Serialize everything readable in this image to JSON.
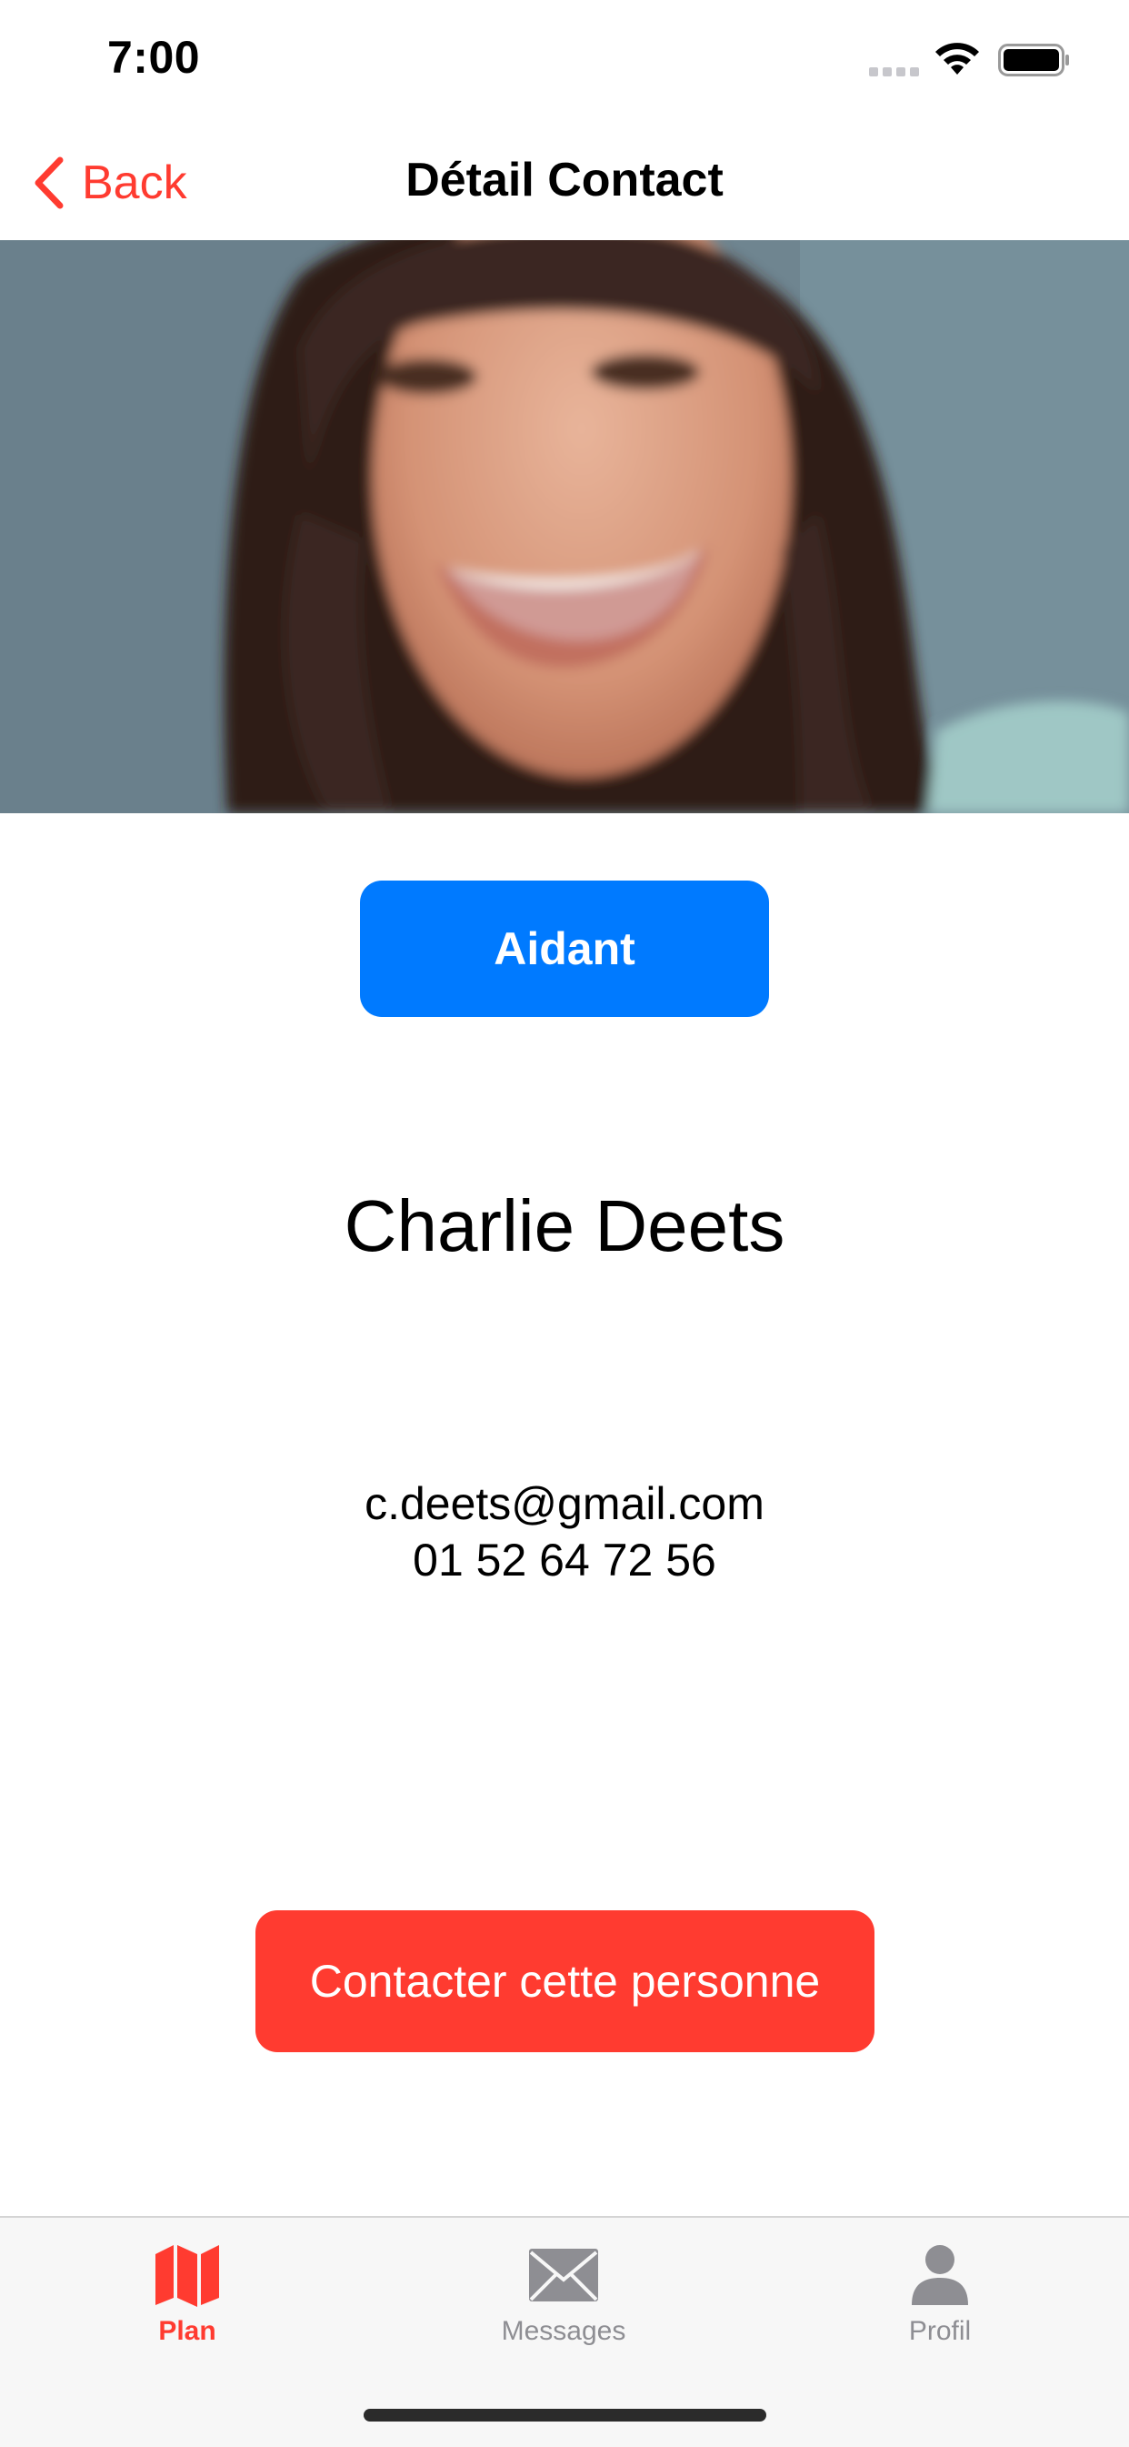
{
  "status_bar": {
    "time": "7:00"
  },
  "nav": {
    "back_label": "Back",
    "title": "Détail Contact"
  },
  "contact": {
    "role": "Aidant",
    "name": "Charlie Deets",
    "email": "c.deets@gmail.com",
    "phone": "01 52 64 72 56"
  },
  "actions": {
    "contact_button": "Contacter cette personne"
  },
  "tab_bar": {
    "items": [
      {
        "label": "Plan",
        "icon": "map-icon",
        "active": true
      },
      {
        "label": "Messages",
        "icon": "envelope-icon",
        "active": false
      },
      {
        "label": "Profil",
        "icon": "person-icon",
        "active": false
      }
    ]
  },
  "colors": {
    "accent": "#ff3b30",
    "primary_button": "#007aff",
    "inactive": "#8e8e93"
  }
}
